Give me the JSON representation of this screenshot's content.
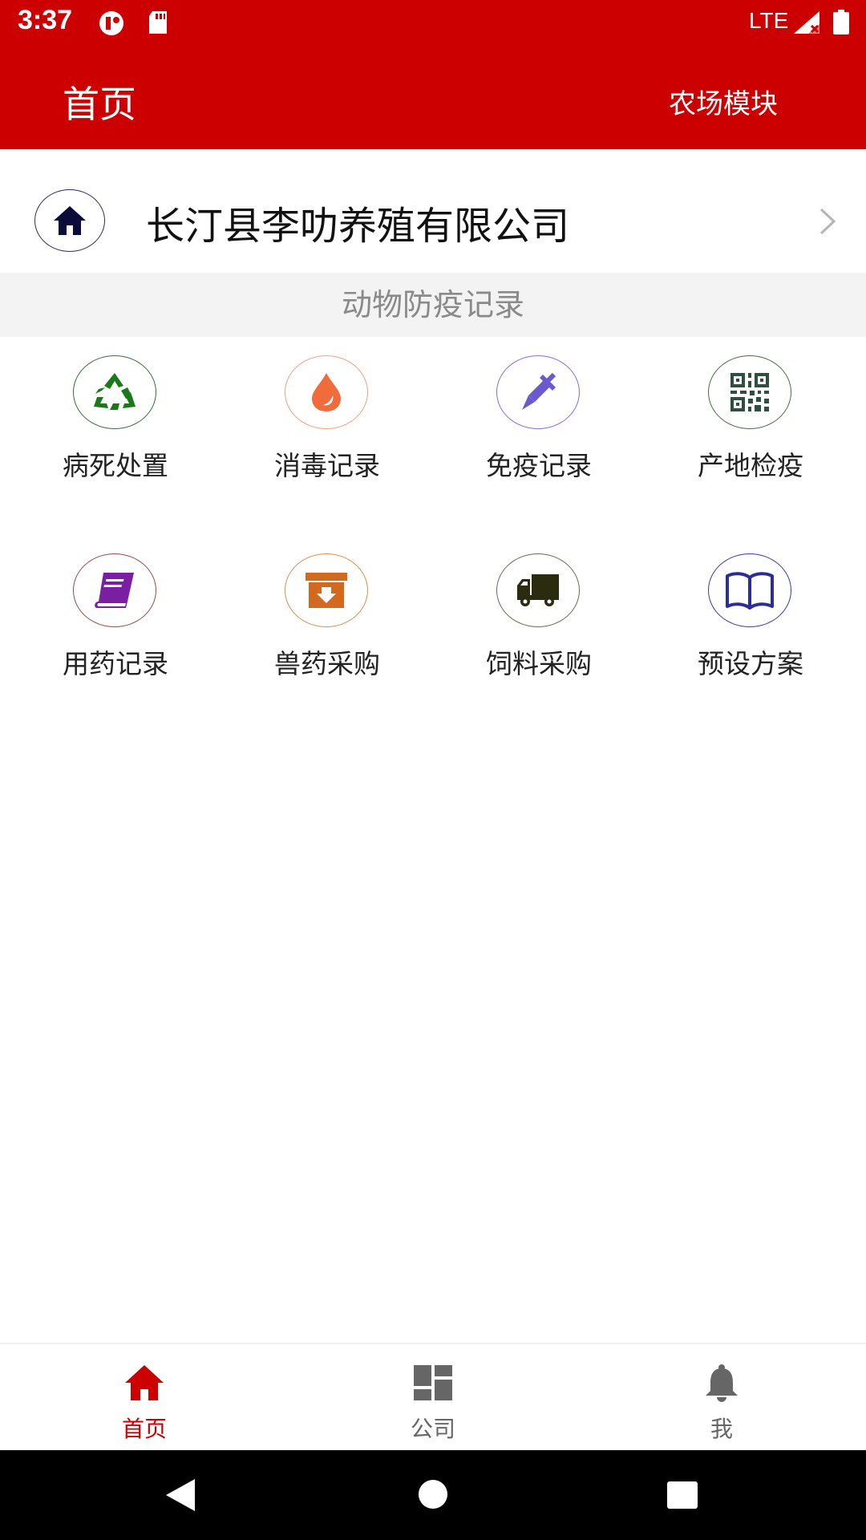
{
  "status_bar": {
    "time": "3:37",
    "network": "LTE",
    "icons": [
      "pause-circle-icon",
      "sd-card-icon",
      "signal-icon",
      "battery-icon"
    ]
  },
  "app_bar": {
    "title": "首页",
    "action": "农场模块",
    "color": "#cc0000"
  },
  "company": {
    "name": "长汀县李叻养殖有限公司",
    "icon": "home-icon"
  },
  "section": {
    "title": "动物防疫记录"
  },
  "grid_items": [
    {
      "label": "病死处置",
      "icon": "recycle-icon",
      "color": "#1a7a1a"
    },
    {
      "label": "消毒记录",
      "icon": "drop-icon",
      "color": "#f26b3a"
    },
    {
      "label": "免疫记录",
      "icon": "syringe-icon",
      "color": "#6a5acd"
    },
    {
      "label": "产地检疫",
      "icon": "qr-code-icon",
      "color": "#2f4f3f"
    },
    {
      "label": "用药记录",
      "icon": "book-icon",
      "color": "#7a1fa2"
    },
    {
      "label": "兽药采购",
      "icon": "archive-box-icon",
      "color": "#d2691e"
    },
    {
      "label": "饲料采购",
      "icon": "truck-icon",
      "color": "#2b2b10"
    },
    {
      "label": "预设方案",
      "icon": "open-book-icon",
      "color": "#2c2c9a"
    }
  ],
  "bottom_nav": {
    "items": [
      {
        "label": "首页",
        "icon": "home-icon",
        "active": true
      },
      {
        "label": "公司",
        "icon": "dashboard-icon",
        "active": false
      },
      {
        "label": "我",
        "icon": "bell-icon",
        "active": false
      }
    ],
    "active_color": "#cc0000",
    "inactive_color": "#666666"
  }
}
